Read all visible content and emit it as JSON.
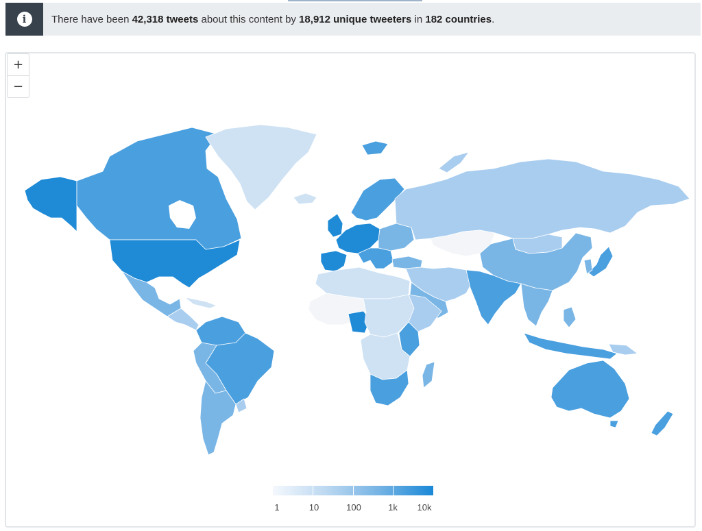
{
  "info": {
    "text_prefix": "There have been ",
    "tweets": "42,318 tweets",
    "text_middle": " about this content by ",
    "tweeters": "18,912 unique tweeters",
    "text_in": " in ",
    "countries": "182 countries",
    "text_end": "."
  },
  "zoom": {
    "in_label": "+",
    "out_label": "−"
  },
  "legend": {
    "labels": [
      "1",
      "10",
      "100",
      "1k",
      "10k"
    ]
  },
  "colors": {
    "c0": "#f3f5f8",
    "c1": "#cfe2f4",
    "c2": "#a9cdef",
    "c3": "#79b6e6",
    "c4": "#4a9fdf",
    "c5": "#1f8ad6"
  }
}
